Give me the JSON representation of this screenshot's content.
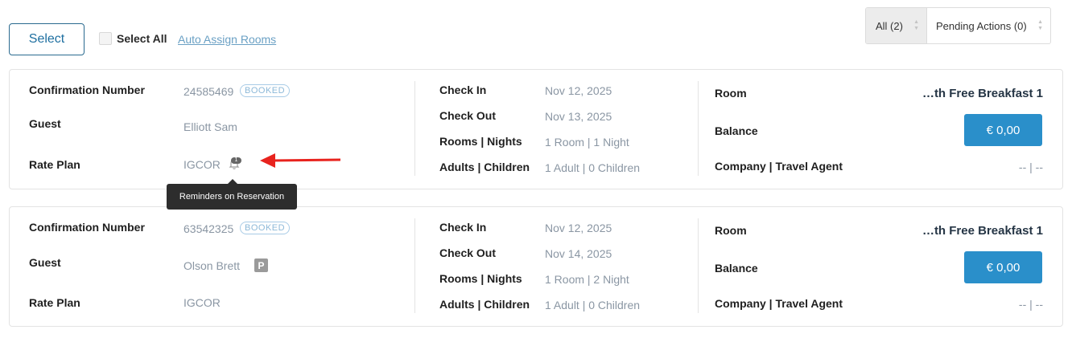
{
  "toolbar": {
    "select_label": "Select",
    "select_all_label": "Select All",
    "auto_assign_label": "Auto Assign Rooms",
    "filter": {
      "all_label": "All (2)",
      "pending_label": "Pending Actions (0)"
    }
  },
  "labels": {
    "confirmation": "Confirmation Number",
    "guest": "Guest",
    "rate_plan": "Rate Plan",
    "check_in": "Check In",
    "check_out": "Check Out",
    "rooms_nights": "Rooms | Nights",
    "adults_children": "Adults | Children",
    "room": "Room",
    "balance": "Balance",
    "company": "Company | Travel Agent"
  },
  "reservations": [
    {
      "confirmation_number": "24585469",
      "status": "BOOKED",
      "guest": "Elliott Sam",
      "rate_plan": "IGCOR",
      "reminder_count": "1",
      "check_in": "Nov 12, 2025",
      "check_out": "Nov 13, 2025",
      "rooms_nights": "1 Room | 1 Night",
      "adults_children": "1 Adult | 0 Children",
      "room": "…th Free Breakfast 1",
      "balance": "€ 0,00",
      "company": "-- | --"
    },
    {
      "confirmation_number": "63542325",
      "status": "BOOKED",
      "guest": "Olson Brett",
      "guest_icon": "P",
      "rate_plan": "IGCOR",
      "check_in": "Nov 12, 2025",
      "check_out": "Nov 14, 2025",
      "rooms_nights": "1 Room | 2 Night",
      "adults_children": "1 Adult | 0 Children",
      "room": "…th Free Breakfast 1",
      "balance": "€ 0,00",
      "company": "-- | --"
    }
  ],
  "tooltip": "Reminders on Reservation",
  "colors": {
    "accent": "#2a8fca",
    "annotation_arrow": "#e8231e"
  }
}
